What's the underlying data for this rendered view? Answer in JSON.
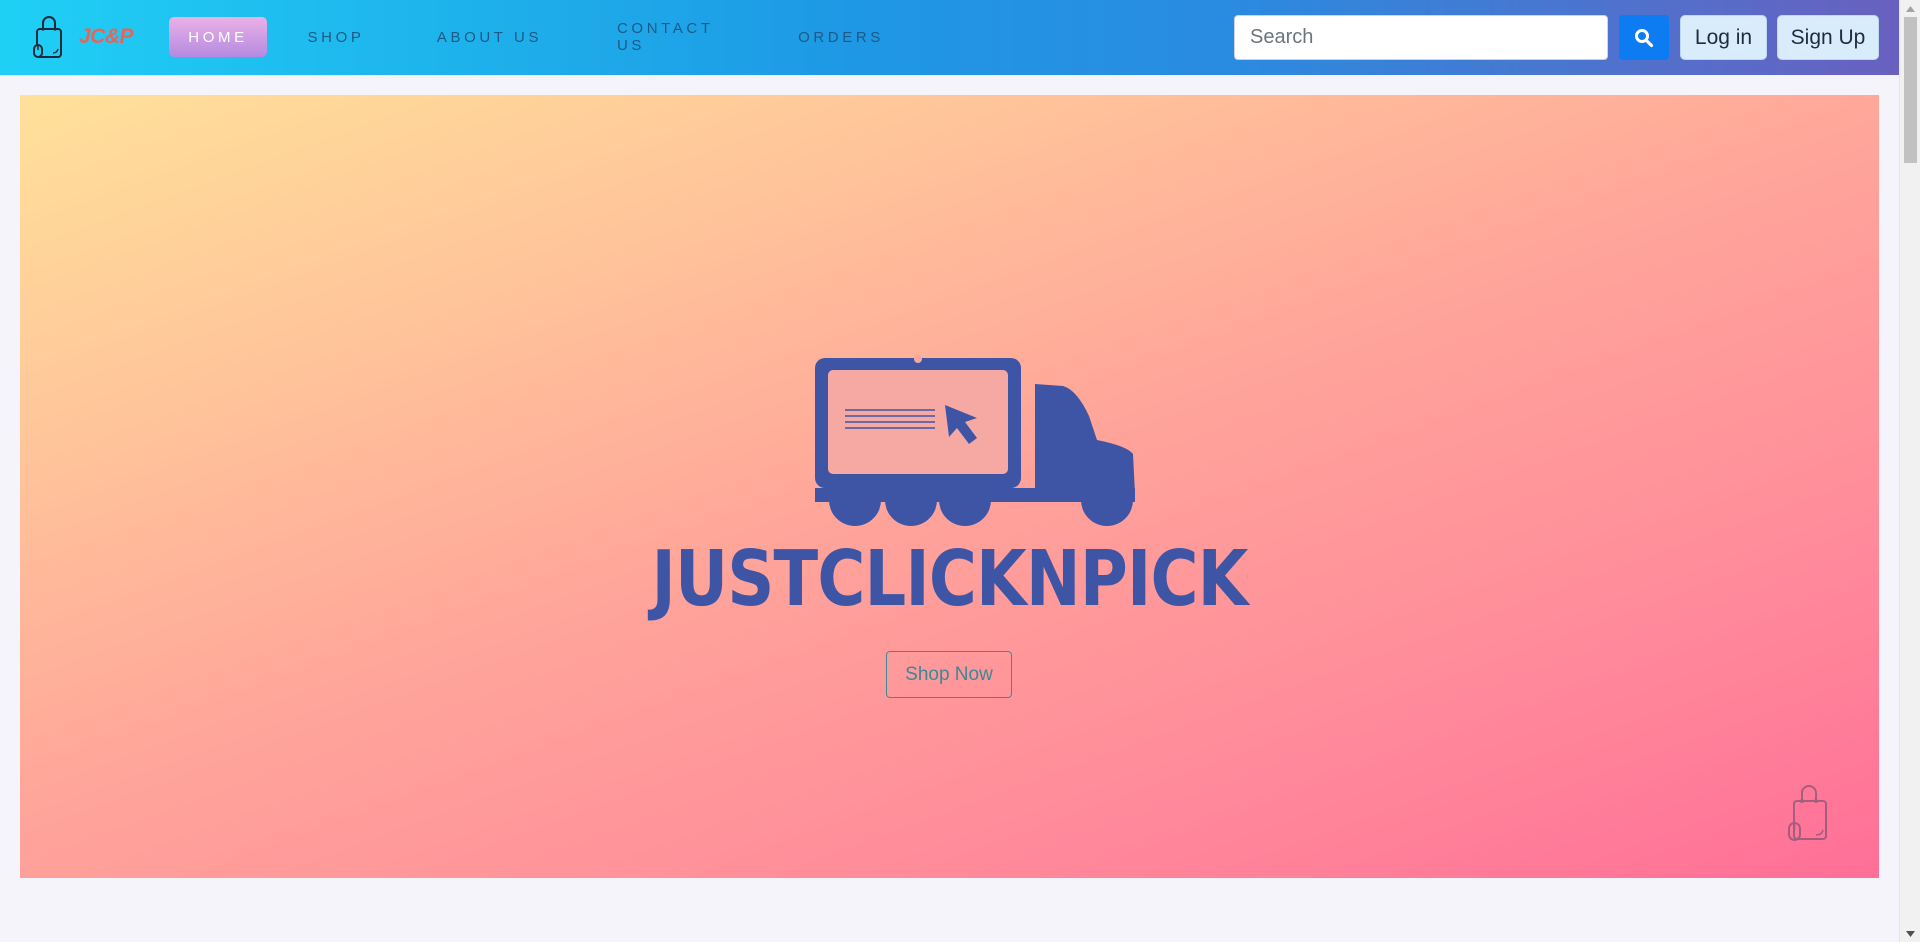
{
  "brand": {
    "name": "JC&P",
    "icon": "shopping-bag-icon"
  },
  "nav": {
    "items": [
      {
        "label": "HOME",
        "active": true
      },
      {
        "label": "SHOP"
      },
      {
        "label": "ABOUT US"
      },
      {
        "label": "CONTACT US"
      },
      {
        "label": "ORDERS"
      }
    ]
  },
  "search": {
    "placeholder": "Search",
    "value": "",
    "icon": "search-icon"
  },
  "auth": {
    "login_label": "Log in",
    "signup_label": "Sign Up"
  },
  "hero": {
    "logo_text": "JUSTCLICKNPICK",
    "logo_icon": "delivery-truck-laptop-icon",
    "cta_label": "Shop Now",
    "corner_icon": "shopping-bag-icon"
  },
  "colors": {
    "nav_gradient_start": "#1fd0f5",
    "nav_gradient_end": "#6960bf",
    "brand_text": "#e8645a",
    "logo_blue": "#3e55a5",
    "search_button": "#0d7cf2",
    "hero_gradient_start": "#ffe19a",
    "hero_gradient_end": "#ff6f98"
  }
}
